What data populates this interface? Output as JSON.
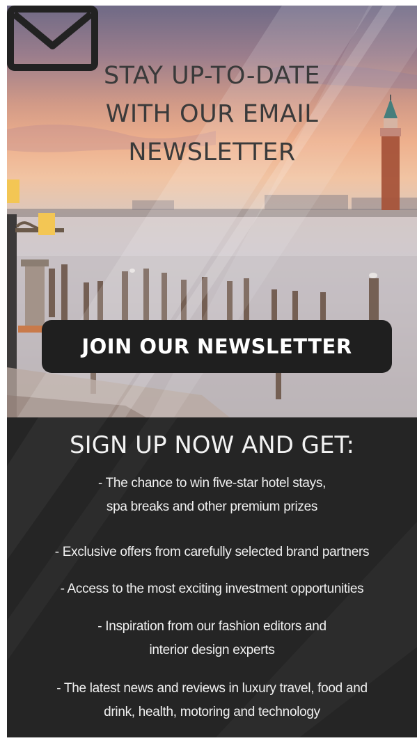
{
  "hero": {
    "headline_lines": [
      "STAY UP-TO-DATE",
      "WITH OUR EMAIL",
      "NEWSLETTER"
    ],
    "envelope_icon": "envelope-icon",
    "join_button_label": "JOIN OUR NEWSLETTER"
  },
  "benefits": {
    "title": "SIGN UP NOW AND GET:",
    "items": [
      {
        "lines": [
          "- The chance to win five-star hotel stays,",
          "spa breaks and other premium prizes"
        ]
      },
      {
        "lines": [
          "- Exclusive offers from carefully selected brand partners"
        ]
      },
      {
        "lines": [
          "- Access to the most exciting investment opportunities"
        ]
      },
      {
        "lines": [
          "- Inspiration from our fashion editors and",
          "interior design experts"
        ]
      },
      {
        "lines": [
          "- The latest news and reviews in luxury travel, food and",
          "drink, health, motoring and technology"
        ]
      }
    ]
  },
  "colors": {
    "panel_background": "#252525",
    "button_background": "#1f1f1f",
    "headline_text": "#3a3a3a",
    "light_text": "#f0f0f0"
  }
}
